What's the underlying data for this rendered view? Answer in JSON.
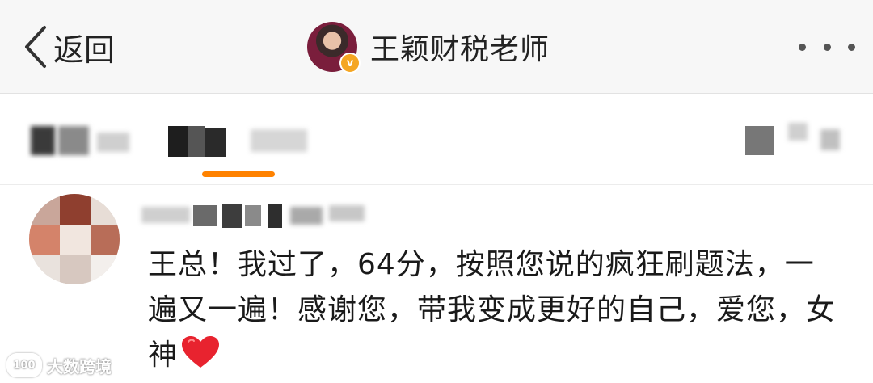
{
  "nav": {
    "back_label": "返回",
    "profile_name": "王颖财税老师",
    "verified_badge": "v",
    "more_icon": "ellipsis-icon"
  },
  "tabs": {
    "active_index": 1,
    "labels_obscured": true
  },
  "comment": {
    "text": "王总！我过了，64分，按照您说的疯狂刷题法，一遍又一遍！感谢您，带我变成更好的自己，爱您，女神",
    "emoji": "red-heart",
    "author_obscured": true
  },
  "watermark": {
    "text": "大数跨境",
    "logo_text": "100"
  },
  "colors": {
    "accent": "#ff8200",
    "badge": "#f5a623",
    "heart": "#e8232f",
    "nav_bg": "#f7f7f7"
  }
}
